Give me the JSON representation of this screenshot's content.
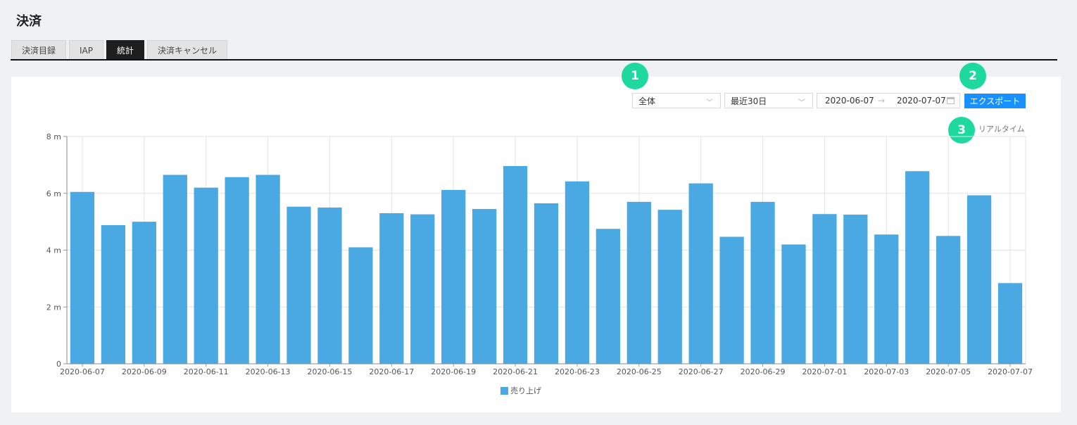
{
  "page": {
    "title": "決済"
  },
  "tabs": [
    {
      "label": "決済目録",
      "active": false
    },
    {
      "label": "IAP",
      "active": false
    },
    {
      "label": "統計",
      "active": true
    },
    {
      "label": "決済キャンセル",
      "active": false
    }
  ],
  "filters": {
    "category": "全体",
    "period": "最近30日",
    "date_from": "2020-06-07",
    "date_to": "2020-07-07",
    "date_separator": "→"
  },
  "export_label": "エクスポート",
  "realtime_label": "リアルタイム",
  "badges": [
    "1",
    "2",
    "3"
  ],
  "colors": {
    "bar": "#4aa8e3",
    "badge": "#1dd9a0",
    "export": "#1890ff",
    "active_tab": "#1e1e1e"
  },
  "chart_data": {
    "type": "bar",
    "categories": [
      "2020-06-07",
      "2020-06-08",
      "2020-06-09",
      "2020-06-10",
      "2020-06-11",
      "2020-06-12",
      "2020-06-13",
      "2020-06-14",
      "2020-06-15",
      "2020-06-16",
      "2020-06-17",
      "2020-06-18",
      "2020-06-19",
      "2020-06-20",
      "2020-06-21",
      "2020-06-22",
      "2020-06-23",
      "2020-06-24",
      "2020-06-25",
      "2020-06-26",
      "2020-06-27",
      "2020-06-28",
      "2020-06-29",
      "2020-06-30",
      "2020-07-01",
      "2020-07-02",
      "2020-07-03",
      "2020-07-04",
      "2020-07-05",
      "2020-07-06",
      "2020-07-07"
    ],
    "tick_labels": [
      "2020-06-07",
      "2020-06-09",
      "2020-06-11",
      "2020-06-13",
      "2020-06-15",
      "2020-06-17",
      "2020-06-19",
      "2020-06-21",
      "2020-06-23",
      "2020-06-25",
      "2020-06-27",
      "2020-06-29",
      "2020-07-01",
      "2020-07-03",
      "2020-07-05",
      "2020-07-07"
    ],
    "series": [
      {
        "name": "売り上げ",
        "values": [
          6.05,
          4.88,
          5.0,
          6.65,
          6.2,
          6.57,
          6.65,
          5.53,
          5.5,
          4.1,
          5.3,
          5.26,
          6.12,
          5.45,
          6.96,
          5.65,
          6.42,
          4.75,
          5.7,
          5.42,
          6.35,
          4.47,
          5.7,
          4.2,
          5.27,
          5.25,
          4.55,
          6.78,
          4.5,
          5.93,
          2.84
        ]
      }
    ],
    "ylim": [
      0,
      8
    ],
    "y_ticks": [
      0,
      2,
      4,
      6,
      8
    ],
    "y_tick_labels": [
      "0",
      "2 m",
      "4 m",
      "6 m",
      "8 m"
    ],
    "grid": true,
    "legend": "bottom-center"
  }
}
